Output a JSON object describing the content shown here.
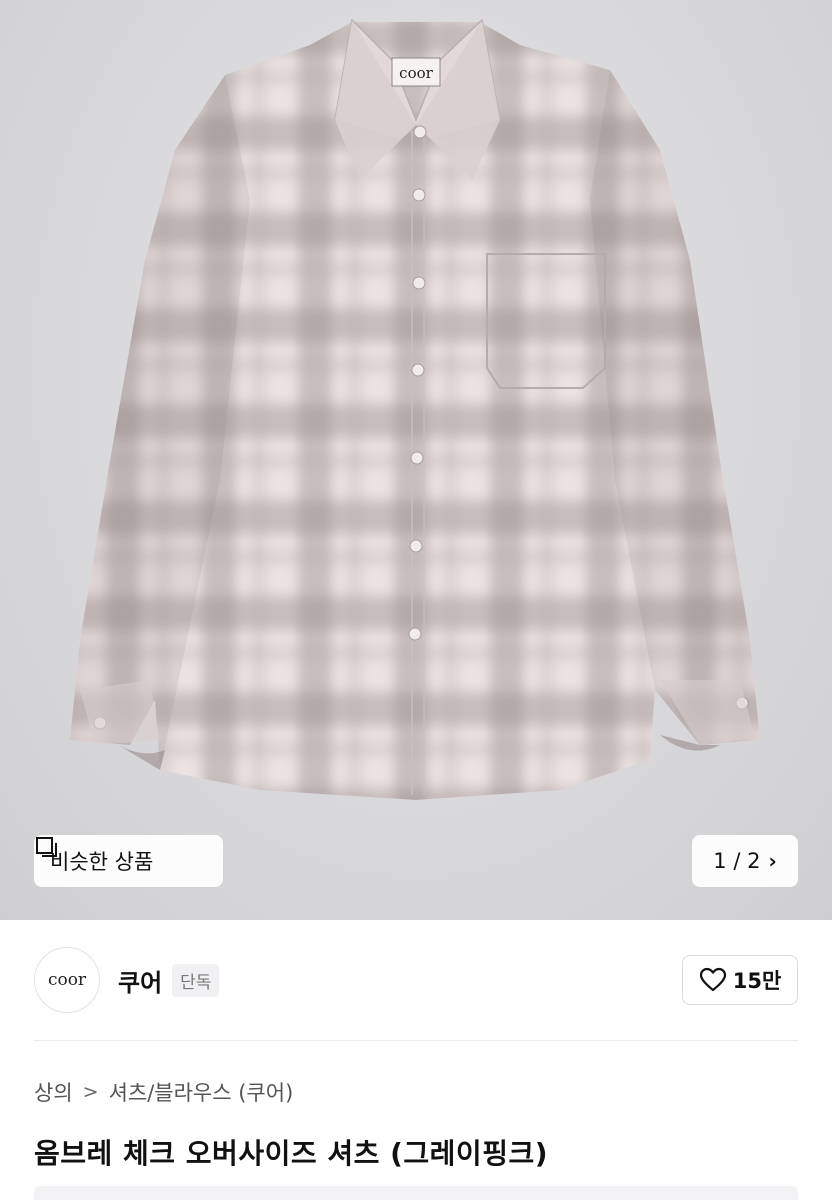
{
  "hero": {
    "image_subject": "plaid-shirt-photo",
    "shirt_label": "coor",
    "similar_label": "비슷한 상품",
    "pager_label": "1 / 2",
    "icons": {
      "similar": "similar-products-icon",
      "next": "chevron-right-icon"
    }
  },
  "brand": {
    "logo_text": "coor",
    "name": "쿠어",
    "badge": "단독",
    "like_count": "15만",
    "like_icon": "heart-icon"
  },
  "breadcrumb": {
    "items": [
      "상의",
      "셔츠/블라우스 (쿠어)"
    ],
    "separator": ">"
  },
  "product": {
    "title": "옴브레 체크 오버사이즈 셔츠 (그레이핑크)"
  },
  "colors": {
    "shirt_base": "#e9dede",
    "shirt_check": "#9c9291",
    "hero_bg": "#d9d9dc"
  }
}
